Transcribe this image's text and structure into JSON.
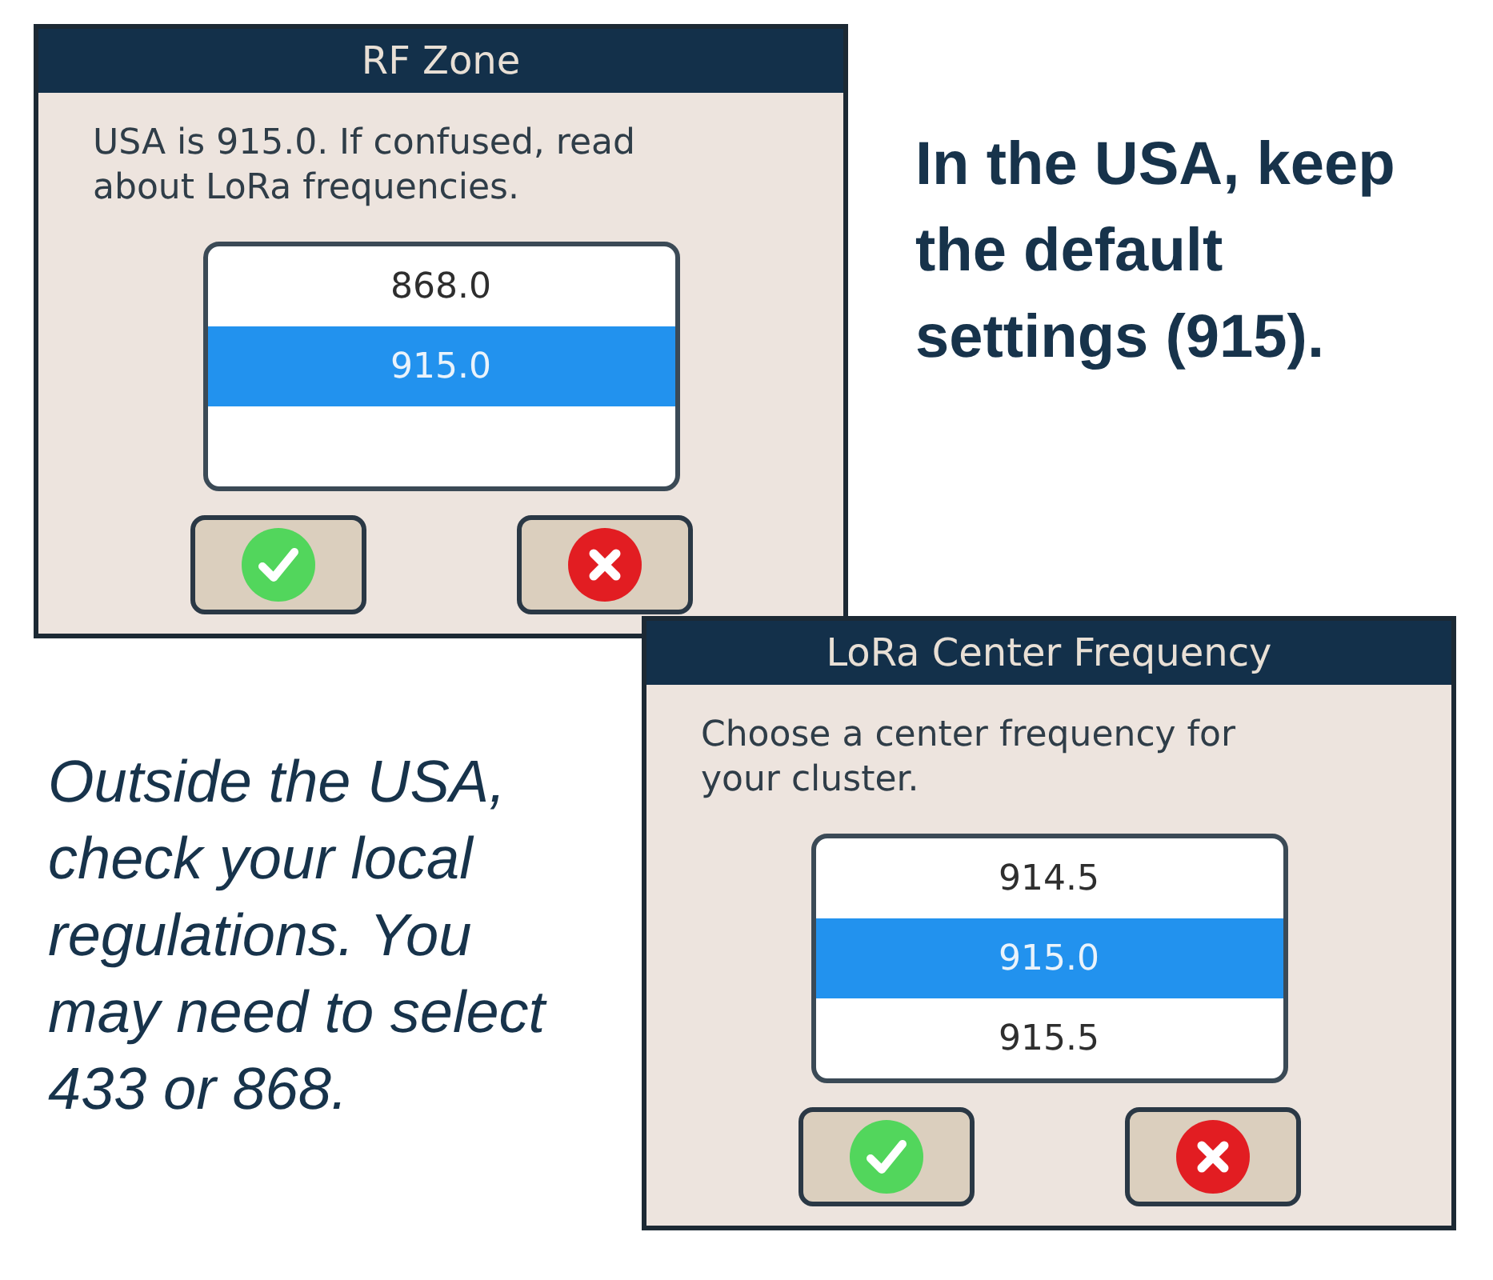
{
  "dialogs": [
    {
      "title": "RF Zone",
      "message": "USA is 915.0. If confused, read about LoRa frequencies.",
      "options": [
        {
          "label": "868.0",
          "selected": false
        },
        {
          "label": "915.0",
          "selected": true
        }
      ],
      "buttons": [
        {
          "kind": "confirm"
        },
        {
          "kind": "cancel"
        }
      ]
    },
    {
      "title": "LoRa Center Frequency",
      "message": "Choose a center frequency for your cluster.",
      "options": [
        {
          "label": "914.5",
          "selected": false
        },
        {
          "label": "915.0",
          "selected": true
        },
        {
          "label": "915.5",
          "selected": false
        }
      ],
      "buttons": [
        {
          "kind": "confirm"
        },
        {
          "kind": "cancel"
        }
      ]
    }
  ],
  "notes": [
    {
      "kind": "bold",
      "text": "In the USA, keep the default settings (915)."
    },
    {
      "kind": "italic",
      "text": "Outside the USA, check your local regulations. You may need to select 433 or 868."
    }
  ]
}
